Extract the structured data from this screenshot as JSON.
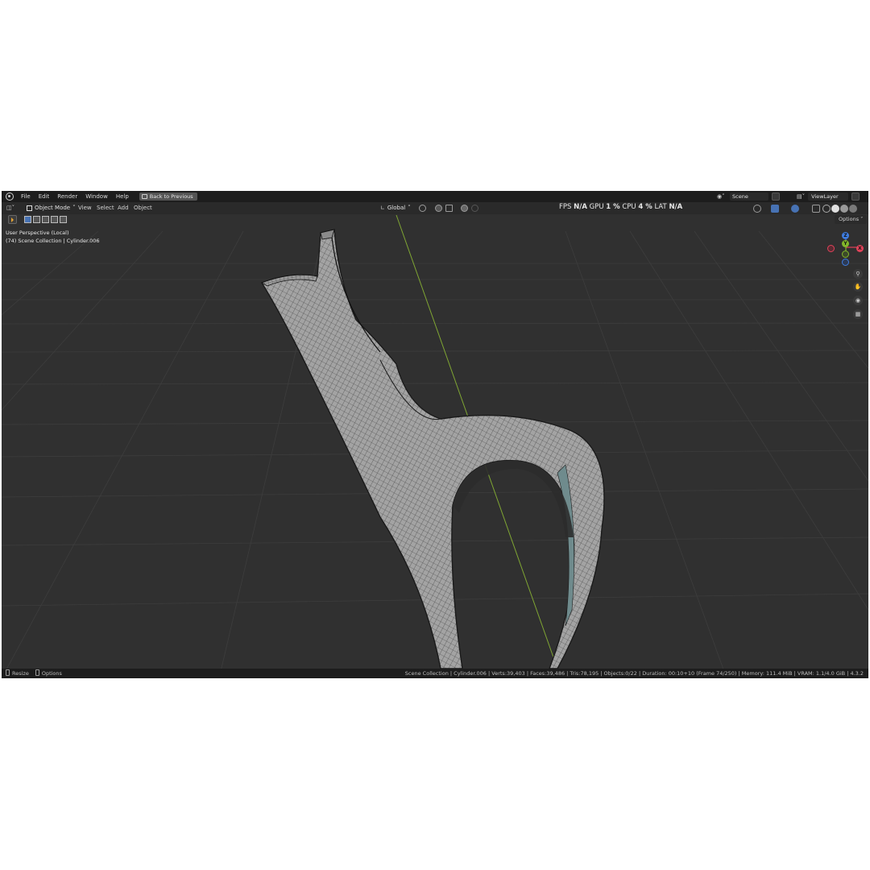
{
  "topbar": {
    "menu": [
      "File",
      "Edit",
      "Render",
      "Window",
      "Help"
    ],
    "back_button": "Back to Previous",
    "scene": "Scene",
    "view_layer": "ViewLayer"
  },
  "header": {
    "mode": "Object Mode",
    "menu": [
      "View",
      "Select",
      "Add",
      "Object"
    ],
    "transform_orientation": "Global",
    "stats": {
      "fps_label": "FPS",
      "fps_value": "N/A",
      "gpu_label": "GPU",
      "gpu_value": "1 %",
      "cpu_label": "CPU",
      "cpu_value": "4 %",
      "lat_label": "LAT",
      "lat_value": "N/A"
    }
  },
  "toolbar": {
    "options_label": "Options"
  },
  "viewport": {
    "perspective": "User Perspective (Local)",
    "collection_info": "(74) Scene Collection | Cylinder.006",
    "gizmo": {
      "x_label": "X",
      "y_label": "Y",
      "z_label": "Z"
    }
  },
  "colors": {
    "x_axis": "#e0435a",
    "y_axis": "#82b62a",
    "z_axis": "#3e7de0",
    "background": "#303030",
    "mesh": "#a9a9a9"
  },
  "statusbar": {
    "left": [
      "Resize",
      "Options"
    ],
    "right": "Scene Collection | Cylinder.006 | Verts:39,403 | Faces:39,486 | Tris:78,195 | Objects:0/22 | Duration: 00:10+10 (Frame 74/250) | Memory: 111.4 MiB | VRAM: 1.1/4.0 GiB | 4.3.2"
  }
}
